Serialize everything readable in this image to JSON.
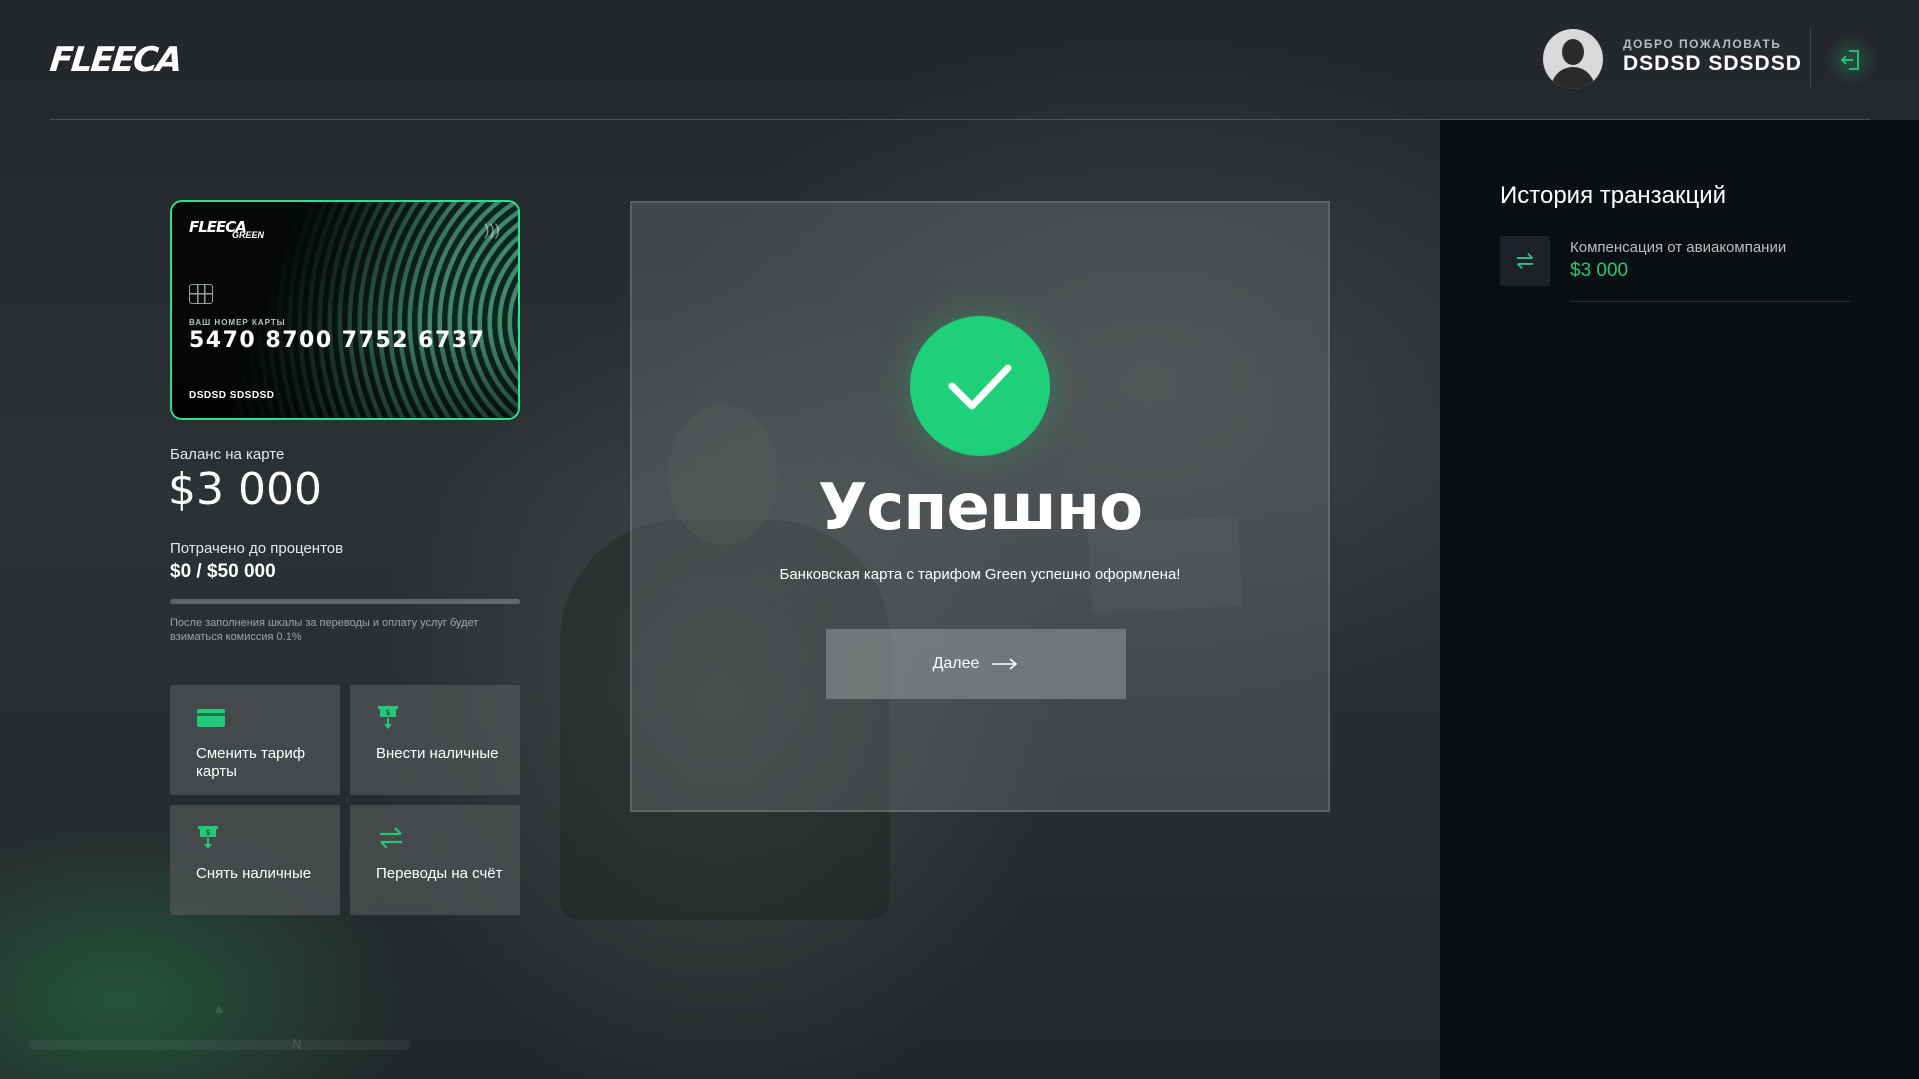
{
  "brand": {
    "logo": "FLEECA",
    "accent": "#22c978"
  },
  "header": {
    "welcome": "ДОБРО ПОЖАЛОВАТЬ",
    "username": "DSDSD SDSDSD",
    "logout_icon": "logout-icon"
  },
  "card": {
    "logo": "FLEECA",
    "tier": "GREEN",
    "number_label": "ВАШ НОМЕР КАРТЫ",
    "number": "5470 8700 7752 6737",
    "holder": "DSDSD SDSDSD",
    "accent": "#2ee08a"
  },
  "balance": {
    "label": "Баланс на карте",
    "value": "$3 000"
  },
  "spending": {
    "label": "Потрачено до процентов",
    "value": "$0 / $50 000",
    "progress_percent": 0,
    "note": "После заполнения шкалы за переводы и оплату услуг будет взиматься комиссия 0.1%"
  },
  "actions": [
    {
      "label": "Сменить тариф карты",
      "icon": "card-icon"
    },
    {
      "label": "Внести наличные",
      "icon": "deposit-cash-icon"
    },
    {
      "label": "Снять наличные",
      "icon": "withdraw-cash-icon"
    },
    {
      "label": "Переводы на счёт",
      "icon": "transfer-icon"
    }
  ],
  "modal": {
    "icon": "checkmark-icon",
    "title": "Успешно",
    "message": "Банковская карта с тарифом Green успешно оформлена!",
    "button_label": "Далее",
    "success_color": "#1fd07a"
  },
  "history": {
    "title": "История транзакций",
    "items": [
      {
        "title": "Компенсация от авиакомпании",
        "amount": "$3 000",
        "icon": "transfer-icon"
      }
    ]
  }
}
